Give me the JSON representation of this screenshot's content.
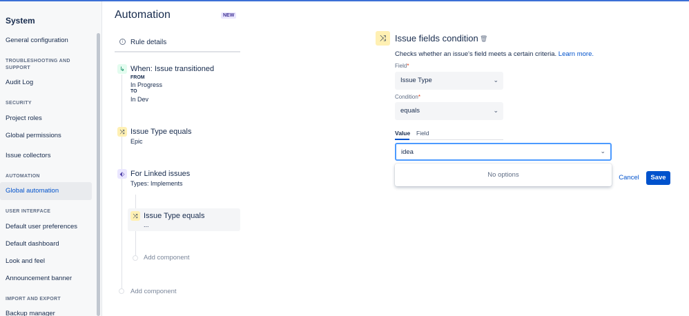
{
  "sidebar": {
    "title": "System",
    "general_configuration": "General configuration",
    "troubleshooting_heading": "TROUBLESHOOTING AND SUPPORT",
    "audit_log": "Audit Log",
    "security_heading": "SECURITY",
    "project_roles": "Project roles",
    "global_permissions": "Global permissions",
    "issue_collectors": "Issue collectors",
    "automation_heading": "AUTOMATION",
    "global_automation": "Global automation",
    "user_interface_heading": "USER INTERFACE",
    "default_user_preferences": "Default user preferences",
    "default_dashboard": "Default dashboard",
    "look_and_feel": "Look and feel",
    "announcement_banner": "Announcement banner",
    "import_export_heading": "IMPORT AND EXPORT",
    "backup_manager": "Backup manager"
  },
  "automation": {
    "title": "Automation",
    "badge": "NEW",
    "rule_details": "Rule details",
    "trigger": {
      "title": "When: Issue transitioned",
      "from_label": "FROM",
      "from_value": "In Progress",
      "to_label": "TO",
      "to_value": "In Dev"
    },
    "condition1": {
      "title": "Issue Type equals",
      "sub": "Epic"
    },
    "branch": {
      "title": "For Linked issues",
      "sub": "Types: Implements"
    },
    "nested_condition": {
      "title": "Issue Type equals",
      "sub": "..."
    },
    "add_component_nested": "Add component",
    "add_component": "Add component"
  },
  "detail": {
    "title": "Issue fields condition",
    "description": "Checks whether an issue's field meets a certain criteria.",
    "learn_more": "Learn more.",
    "field_label": "Field",
    "required_mark": "*",
    "field_value": "Issue Type",
    "condition_label": "Condition",
    "condition_value": "equals",
    "tab_value": "Value",
    "tab_field": "Field",
    "value_input": "idea",
    "no_options": "No options",
    "cancel": "Cancel",
    "save": "Save"
  },
  "icons": {
    "info": "info-icon",
    "trigger": "transition-icon",
    "condition": "shuffle-icon",
    "branch": "branch-icon",
    "trash": "trash-icon",
    "chevron": "chevron-down-icon"
  },
  "colors": {
    "accent": "#0052cc",
    "focus": "#4c9aff",
    "condition_bg": "#fff0b3",
    "trigger_bg": "#e3fcef",
    "branch_bg": "#eae6ff"
  }
}
